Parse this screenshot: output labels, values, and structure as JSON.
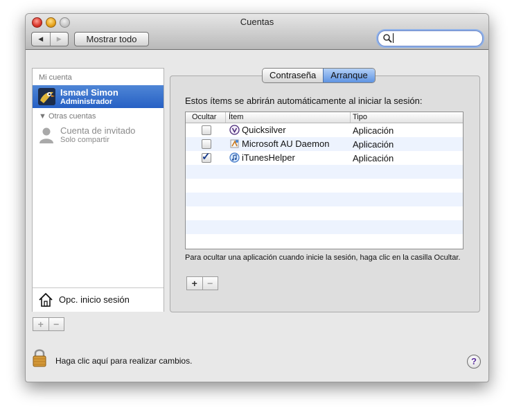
{
  "window": {
    "title": "Cuentas"
  },
  "toolbar": {
    "back_icon": "◀",
    "forward_icon": "▶",
    "show_all_label": "Mostrar todo",
    "search_value": ""
  },
  "sidebar": {
    "my_account_header": "Mi cuenta",
    "account": {
      "name": "Ismael Simon",
      "role": "Administrador"
    },
    "other_accounts_header": "Otras cuentas",
    "guest": {
      "name": "Cuenta de invitado",
      "role": "Solo compartir"
    },
    "login_options_label": "Opc. inicio sesión",
    "add_label": "+",
    "remove_label": "−"
  },
  "tabs": [
    "Contraseña",
    "Arranque"
  ],
  "selected_tab": "Arranque",
  "startup": {
    "description": "Estos ítems se abrirán automáticamente al iniciar la sesión:",
    "columns": {
      "hide": "Ocultar",
      "item": "Ítem",
      "type": "Tipo"
    },
    "rows": [
      {
        "hide": false,
        "icon": "quicksilver-icon",
        "name": "Quicksilver",
        "type": "Aplicación"
      },
      {
        "hide": false,
        "icon": "microsoft-au-icon",
        "name": "Microsoft AU Daemon",
        "type": "Aplicación"
      },
      {
        "hide": true,
        "icon": "itunes-icon",
        "name": "iTunesHelper",
        "type": "Aplicación"
      }
    ],
    "hint": "Para ocultar una aplicación cuando inicie la sesión, haga clic en la casilla Ocultar.",
    "add_label": "+",
    "remove_label": "−"
  },
  "footer": {
    "lock_text": "Haga clic aquí para realizar cambios.",
    "help_label": "?"
  }
}
